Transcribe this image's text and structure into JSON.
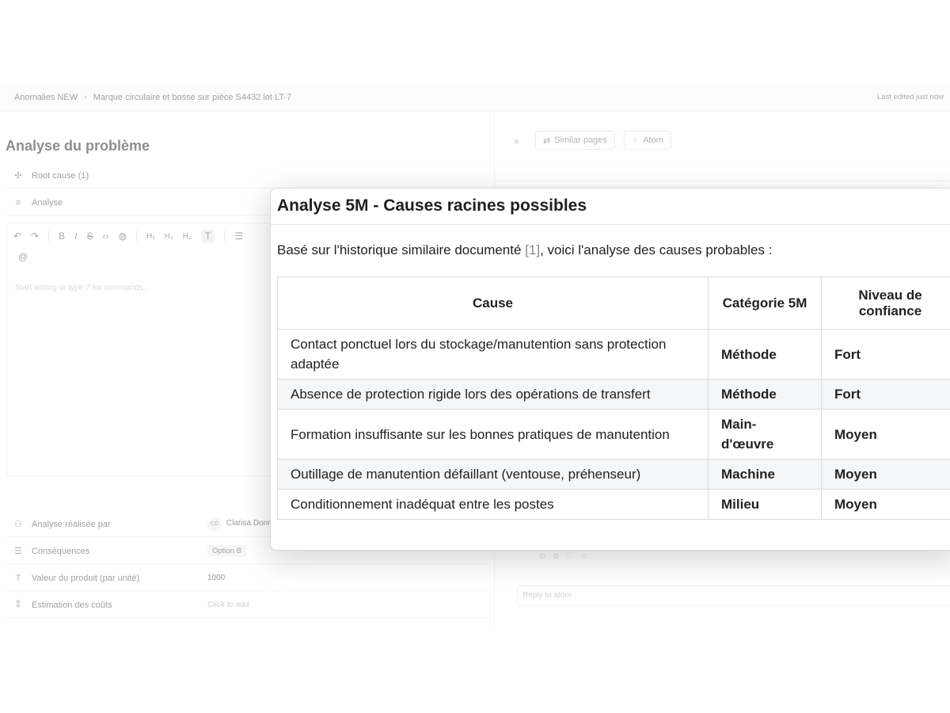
{
  "topbar": {
    "breadcrumb": [
      "Anomalies NEW",
      "Marque circulaire et bosse sur pièce S4432 lot LT-7"
    ],
    "breadcrumb_sep": "›",
    "last_edited": "Last edited just now"
  },
  "left": {
    "section_title": "Analyse du problème",
    "root_cause_label": "Root cause (1)",
    "analyse_label": "Analyse",
    "toolbar": {
      "undo": "↶",
      "redo": "↷",
      "bold": "B",
      "italic": "I",
      "strike": "S",
      "code": "‹›",
      "color": "◍",
      "h1": "H₁",
      "h2": "H₂",
      "h3": "H₃",
      "text": "T",
      "list": "☰",
      "mention": "@"
    },
    "editor_placeholder": "Start writing or type '/' for commands...",
    "properties": [
      {
        "label": "Analyse réalisée par",
        "avatar": "CD",
        "value": "Clarisa Donr"
      },
      {
        "label": "Conséquences",
        "value": "Option B"
      },
      {
        "label": "Valeur du produit (par unité)",
        "value": "1000"
      },
      {
        "label": "Estimation des coûts",
        "value": "Click to add."
      }
    ]
  },
  "right": {
    "collapse": "»",
    "similar_pages": "Similar pages",
    "atom": "Atom",
    "reactions": "⊙ ⊘ ♡ ☺",
    "reply_placeholder": "Reply to atom"
  },
  "card": {
    "title": "Analyse 5M - Causes racines possibles",
    "intro_before": "Basé sur l'historique similaire documenté ",
    "intro_cite": "[1]",
    "intro_after": ", voici l'analyse des causes probables :",
    "headers": [
      "Cause",
      "Catégorie 5M",
      "Niveau de confiance"
    ],
    "rows": [
      {
        "cause": "Contact ponctuel lors du stockage/manutention sans protection adaptée",
        "category": "Méthode",
        "confidence": "Fort"
      },
      {
        "cause": "Absence de protection rigide lors des opérations de transfert",
        "category": "Méthode",
        "confidence": "Fort"
      },
      {
        "cause": "Formation insuffisante sur les bonnes pratiques de manutention",
        "category": "Main-d'œuvre",
        "confidence": "Moyen"
      },
      {
        "cause": "Outillage de manutention défaillant (ventouse, préhenseur)",
        "category": "Machine",
        "confidence": "Moyen"
      },
      {
        "cause": "Conditionnement inadéquat entre les postes",
        "category": "Milieu",
        "confidence": "Moyen"
      }
    ]
  }
}
